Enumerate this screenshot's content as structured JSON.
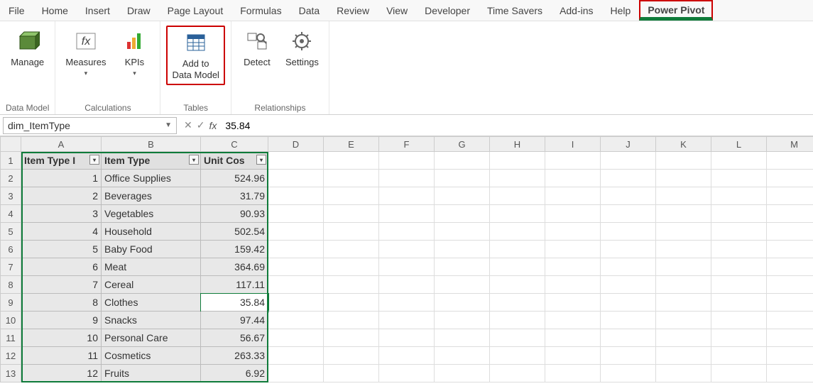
{
  "menu": {
    "items": [
      "File",
      "Home",
      "Insert",
      "Draw",
      "Page Layout",
      "Formulas",
      "Data",
      "Review",
      "View",
      "Developer",
      "Time Savers",
      "Add-ins",
      "Help",
      "Power Pivot"
    ],
    "activeIndex": 13
  },
  "ribbon": {
    "groups": [
      {
        "label": "Data Model",
        "buttons": [
          {
            "label": "Manage",
            "icon": "cube"
          }
        ]
      },
      {
        "label": "Calculations",
        "buttons": [
          {
            "label": "Measures",
            "icon": "fx",
            "dropdown": true
          },
          {
            "label": "KPIs",
            "icon": "kpi",
            "dropdown": true
          }
        ]
      },
      {
        "label": "Tables",
        "buttons": [
          {
            "label": "Add to Data Model",
            "icon": "table",
            "highlighted": true
          }
        ]
      },
      {
        "label": "Relationships",
        "buttons": [
          {
            "label": "Detect",
            "icon": "detect"
          },
          {
            "label": "Settings",
            "icon": "settings"
          }
        ]
      }
    ]
  },
  "nameBox": "dim_ItemType",
  "formula": "35.84",
  "columns": [
    "A",
    "B",
    "C",
    "D",
    "E",
    "F",
    "G",
    "H",
    "I",
    "J",
    "K",
    "L",
    "M"
  ],
  "extraCols": 10,
  "tableHeaders": [
    "Item Type ID",
    "Item Type",
    "Unit Cost"
  ],
  "tableRows": [
    {
      "id": 1,
      "type": "Office Supplies",
      "cost": "524.96"
    },
    {
      "id": 2,
      "type": "Beverages",
      "cost": "31.79"
    },
    {
      "id": 3,
      "type": "Vegetables",
      "cost": "90.93"
    },
    {
      "id": 4,
      "type": "Household",
      "cost": "502.54"
    },
    {
      "id": 5,
      "type": "Baby Food",
      "cost": "159.42"
    },
    {
      "id": 6,
      "type": "Meat",
      "cost": "364.69"
    },
    {
      "id": 7,
      "type": "Cereal",
      "cost": "117.11"
    },
    {
      "id": 8,
      "type": "Clothes",
      "cost": "35.84"
    },
    {
      "id": 9,
      "type": "Snacks",
      "cost": "97.44"
    },
    {
      "id": 10,
      "type": "Personal Care",
      "cost": "56.67"
    },
    {
      "id": 11,
      "type": "Cosmetics",
      "cost": "263.33"
    },
    {
      "id": 12,
      "type": "Fruits",
      "cost": "6.92"
    }
  ],
  "activeCell": {
    "row": 8,
    "col": "C"
  },
  "colors": {
    "accent": "#0f7b3a",
    "highlight": "#c00"
  }
}
